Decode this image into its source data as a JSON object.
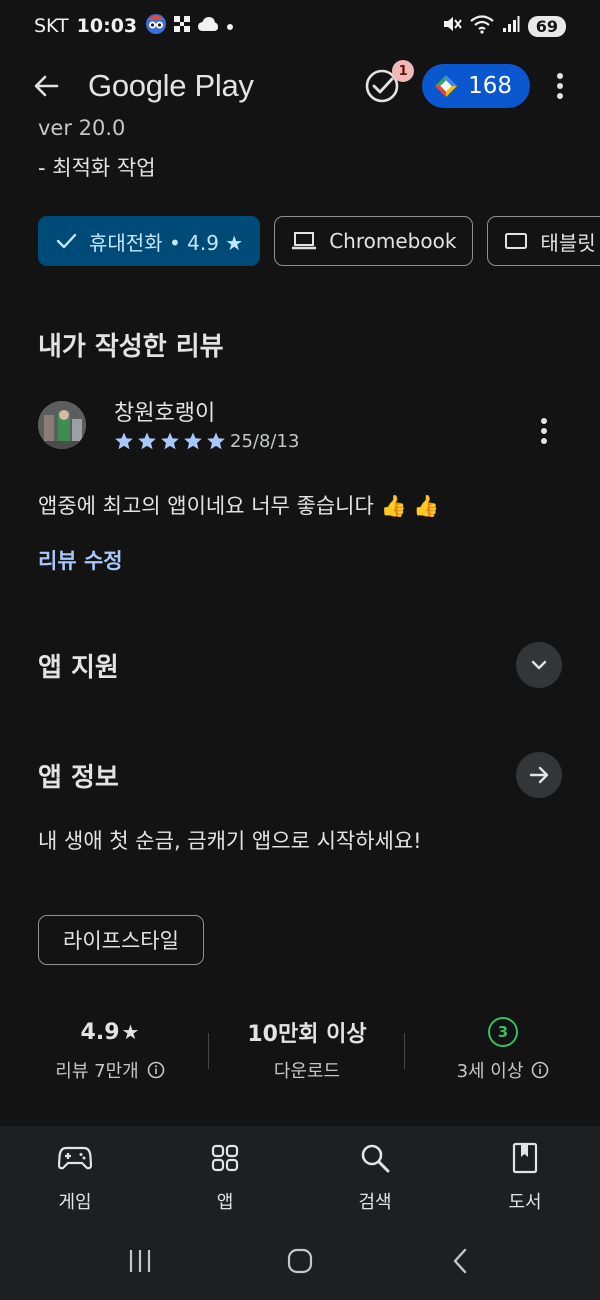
{
  "status_bar": {
    "carrier": "SKT",
    "time": "10:03",
    "battery": "69"
  },
  "app_bar": {
    "brand": "Google Play",
    "notification_count": "1",
    "points": "168"
  },
  "details": {
    "version_partial": "ver 20.0",
    "changelog_line": "- 최적화 작업"
  },
  "device_chips": [
    {
      "label": "휴대전화 • 4.9 ★",
      "selected": true,
      "icon": "check-icon"
    },
    {
      "label": "Chromebook",
      "selected": false,
      "icon": "laptop-icon"
    },
    {
      "label": "태블릿",
      "selected": false,
      "icon": "tablet-icon"
    }
  ],
  "my_review": {
    "section_title": "내가 작성한 리뷰",
    "reviewer_name": "창원호랭이",
    "rating": 5,
    "date": "25/8/13",
    "text": "앱중에 최고의 앱이네요 너무 좋습니다 👍 👍",
    "edit_label": "리뷰 수정"
  },
  "app_support": {
    "label": "앱 지원",
    "icon": "chevron-down-icon"
  },
  "app_info": {
    "label": "앱 정보",
    "icon": "arrow-right-icon",
    "description": "내 생애 첫 순금, 금캐기 앱으로 시작하세요!",
    "category": "라이프스타일"
  },
  "stats": {
    "rating_value": "4.9",
    "rating_star": "★",
    "reviews_label": "리뷰 7만개",
    "downloads_value": "10만회 이상",
    "downloads_label": "다운로드",
    "age_value": "3",
    "age_label": "3세 이상"
  },
  "bottom_nav": {
    "items": [
      {
        "label": "게임",
        "icon": "gamepad-icon"
      },
      {
        "label": "앱",
        "icon": "apps-grid-icon"
      },
      {
        "label": "검색",
        "icon": "search-icon"
      },
      {
        "label": "도서",
        "icon": "bookmark-book-icon"
      }
    ]
  },
  "colors": {
    "background": "#131314",
    "accent_blue": "#0b57d0",
    "link_blue": "#a8c7fa",
    "selected_chip": "#004a77",
    "star_blue": "#a8c7fa",
    "age_green": "#37be5f"
  }
}
